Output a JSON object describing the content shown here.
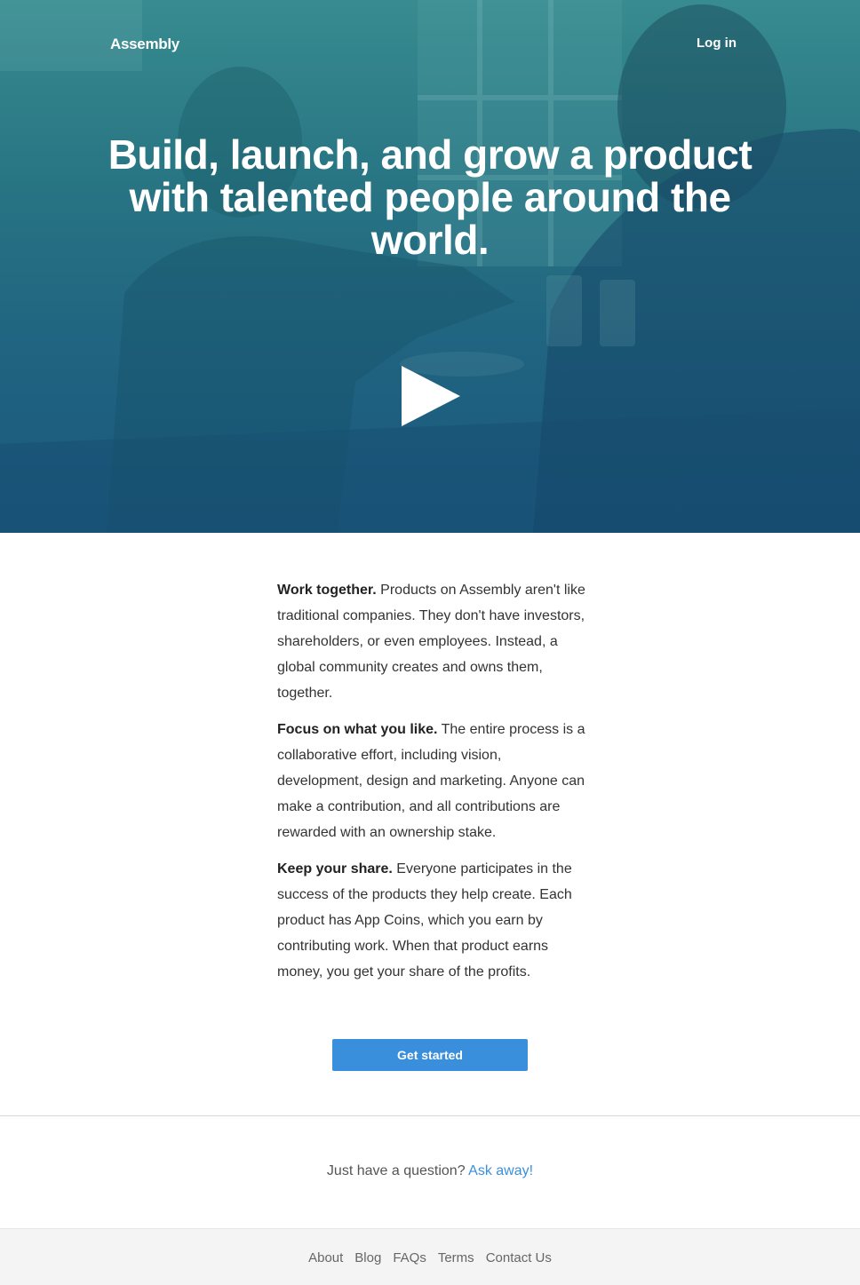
{
  "header": {
    "brand": "Assembly",
    "login_label": "Log in"
  },
  "hero": {
    "title": "Build, launch, and grow a product with talented people around the world."
  },
  "features": [
    {
      "heading": "Work together.",
      "text": " Products on Assembly aren't like traditional companies. They don't have investors, shareholders, or even employees. Instead, a global community creates and owns them, together."
    },
    {
      "heading": "Focus on what you like.",
      "text": " The entire process is a collaborative effort, including vision, development, design and marketing. Anyone can make a contribution, and all contributions are rewarded with an ownership stake."
    },
    {
      "heading": "Keep your share.",
      "text": " Everyone participates in the success of the products they help create. Each product has App Coins, which you earn by contributing work. When that product earns money, you get your share of the profits."
    }
  ],
  "cta": {
    "label": "Get started"
  },
  "question": {
    "prompt": "Just have a question?",
    "link_label": "Ask away!"
  },
  "footer": {
    "links": [
      "About",
      "Blog",
      "FAQs",
      "Terms",
      "Contact Us"
    ]
  },
  "colors": {
    "accent": "#3a8fdc",
    "hero_top": "#3d8f93",
    "hero_bottom": "#1e5a7f"
  },
  "icons": {
    "play": "play-icon"
  }
}
